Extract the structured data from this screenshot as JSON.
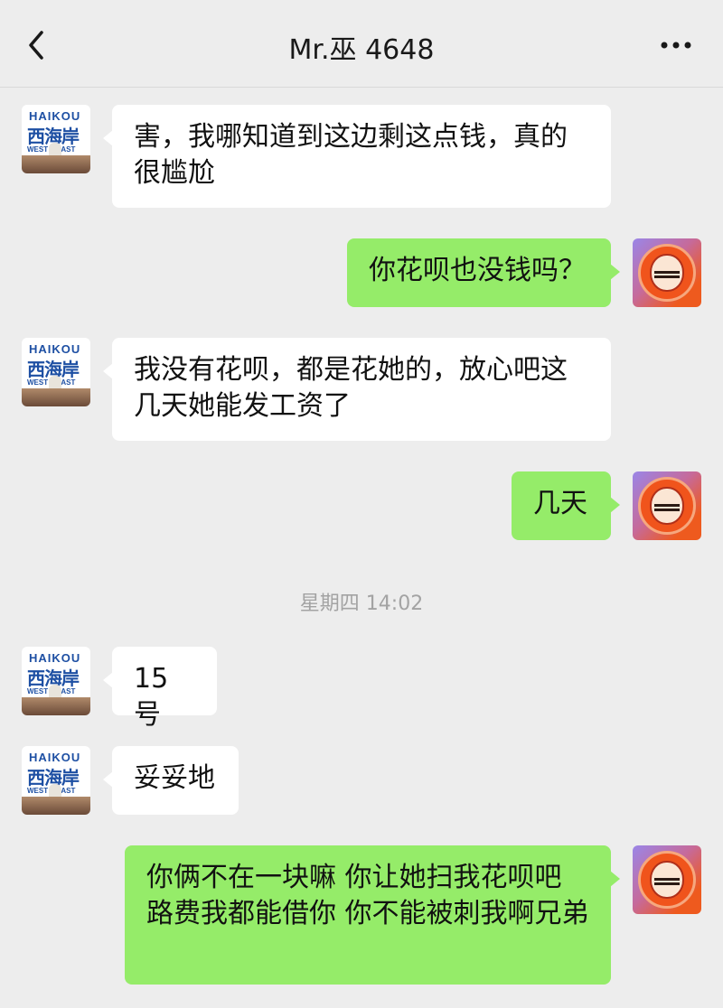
{
  "header": {
    "title": "Mr.巫 4648"
  },
  "avatars": {
    "contact": {
      "line1": "HAIKOU",
      "line2": "西海岸",
      "line3": "WEST COAST"
    }
  },
  "timestamp": "星期四 14:02",
  "messages": [
    {
      "side": "left",
      "text": "害，我哪知道到这边剩这点钱，真的很尴尬"
    },
    {
      "side": "right",
      "text": "你花呗也没钱吗？"
    },
    {
      "side": "left",
      "text": "我没有花呗，都是花她的，放心吧这几天她能发工资了"
    },
    {
      "side": "right",
      "text": "几天"
    },
    {
      "side": "left",
      "text": "15号"
    },
    {
      "side": "left",
      "text": "妥妥地"
    },
    {
      "side": "right",
      "text": "你俩不在一块嘛 你让她扫我花呗吧 路费我都能借你  你不能被刺我啊兄弟"
    }
  ]
}
